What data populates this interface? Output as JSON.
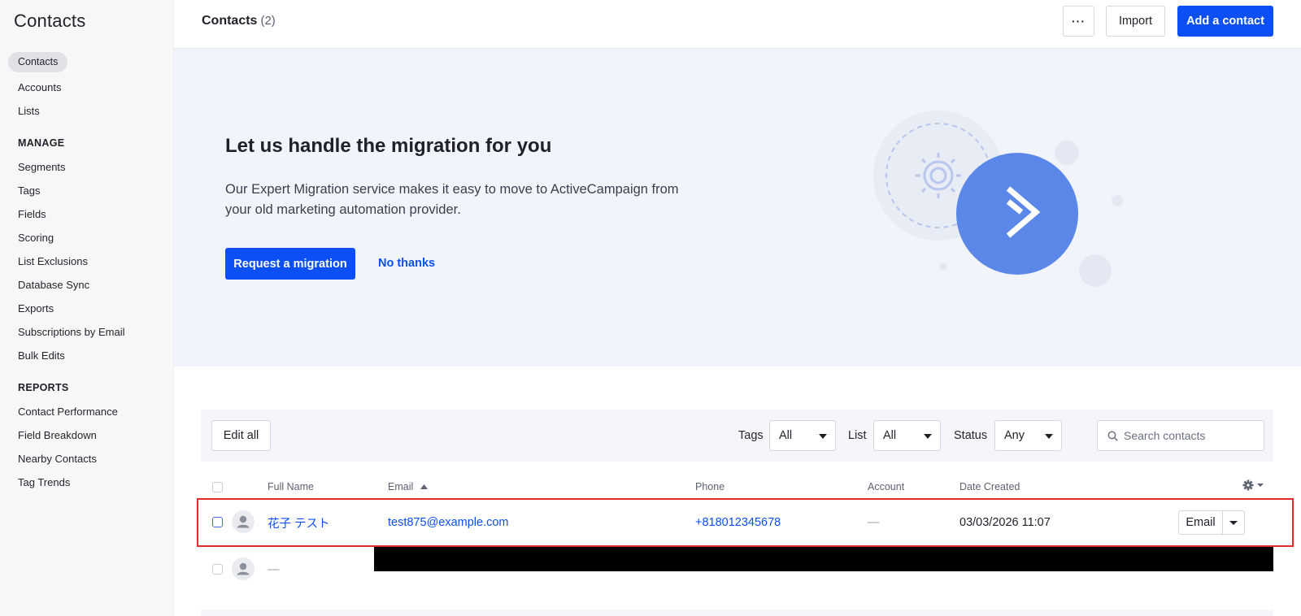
{
  "sidebar": {
    "title": "Contacts",
    "items": [
      {
        "label": "Contacts"
      },
      {
        "label": "Accounts"
      },
      {
        "label": "Lists"
      }
    ],
    "manage": {
      "heading": "MANAGE",
      "items": [
        {
          "label": "Segments"
        },
        {
          "label": "Tags"
        },
        {
          "label": "Fields"
        },
        {
          "label": "Scoring"
        },
        {
          "label": "List Exclusions"
        },
        {
          "label": "Database Sync"
        },
        {
          "label": "Exports"
        },
        {
          "label": "Subscriptions by Email"
        },
        {
          "label": "Bulk Edits"
        }
      ]
    },
    "reports": {
      "heading": "REPORTS",
      "items": [
        {
          "label": "Contact Performance"
        },
        {
          "label": "Field Breakdown"
        },
        {
          "label": "Nearby Contacts"
        },
        {
          "label": "Tag Trends"
        }
      ]
    }
  },
  "header": {
    "title": "Contacts",
    "count": "(2)",
    "more_label": "···",
    "import_label": "Import",
    "add_label": "Add a contact"
  },
  "banner": {
    "headline": "Let us handle the migration for you",
    "body": "Our Expert Migration service makes it easy to move to ActiveCampaign from your old marketing automation provider.",
    "request_label": "Request a migration",
    "dismiss_label": "No thanks"
  },
  "filters": {
    "edit_all_label": "Edit all",
    "tags_label": "Tags",
    "tags_value": "All",
    "list_label": "List",
    "list_value": "All",
    "status_label": "Status",
    "status_value": "Any",
    "search_placeholder": "Search contacts"
  },
  "table": {
    "columns": {
      "full_name": "Full Name",
      "email": "Email",
      "phone": "Phone",
      "account": "Account",
      "date_created": "Date Created"
    },
    "sort": {
      "column": "Email",
      "direction": "ascending"
    },
    "rows": [
      {
        "full_name": "花子 テスト",
        "email": "test875@example.com",
        "phone": "+818012345678",
        "account": "—",
        "date_created": "03/03/2026 11:07",
        "action_label": "Email",
        "highlighted": true
      },
      {
        "full_name": "—",
        "redacted": true
      }
    ]
  },
  "colors": {
    "accent": "#0b4ff5",
    "highlight": "#e32a2a",
    "banner_bg": "#f1f4fa",
    "illustration": "#5b87e8"
  }
}
